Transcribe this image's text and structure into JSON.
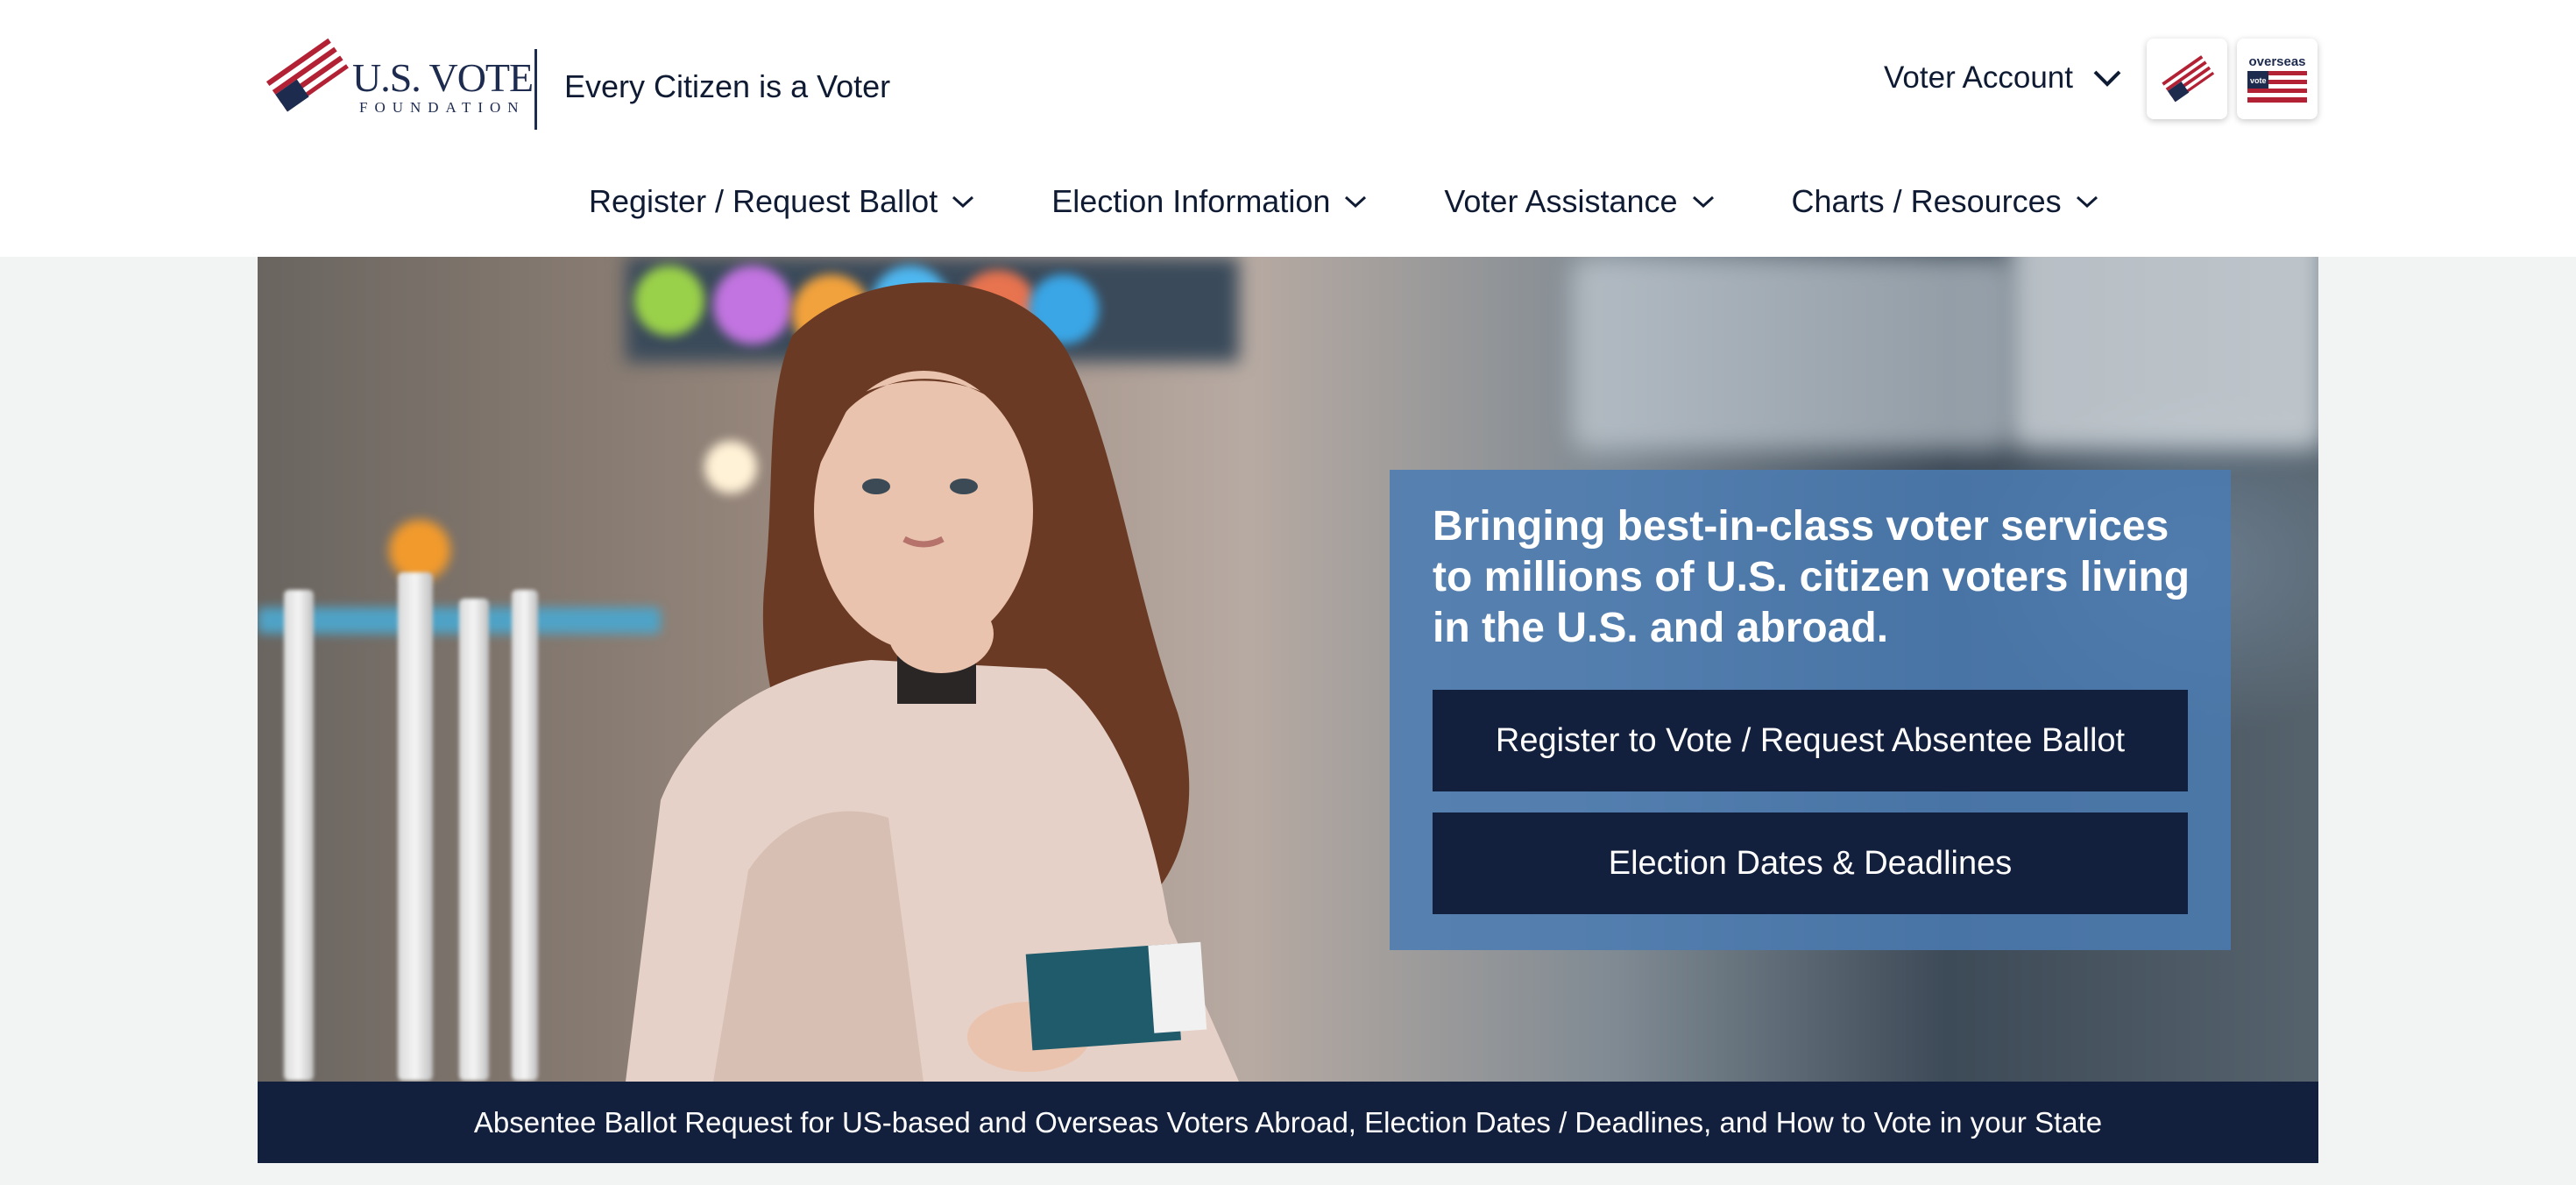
{
  "brand": {
    "logo_line1": "U.S. VOTE",
    "logo_line2": "FOUNDATION",
    "tagline": "Every Citizen is a Voter"
  },
  "account": {
    "label": "Voter Account"
  },
  "badges": {
    "overseas_text": "overseas",
    "overseas_small": "vote"
  },
  "nav": {
    "items": [
      {
        "label": "Register / Request Ballot"
      },
      {
        "label": "Election Information"
      },
      {
        "label": "Voter Assistance"
      },
      {
        "label": "Charts / Resources"
      }
    ]
  },
  "hero": {
    "heading": "Bringing best-in-class voter services to millions of U.S. citizen voters living in the U.S. and abroad.",
    "primary_button": "Register to Vote / Request Absentee Ballot",
    "secondary_button": "Election Dates & Deadlines",
    "caption": "Absentee Ballot Request for US-based and Overseas Voters Abroad, Election Dates / Deadlines, and How to Vote in your State"
  },
  "colors": {
    "navy": "#13203d",
    "panel_blue": "#4a7cb2",
    "flag_red": "#b22234",
    "flag_blue": "#1d2b4f",
    "background": "#f2f4f3"
  },
  "icons": {
    "flag": "flag-checkmark-icon",
    "chevron": "chevron-down-icon"
  }
}
